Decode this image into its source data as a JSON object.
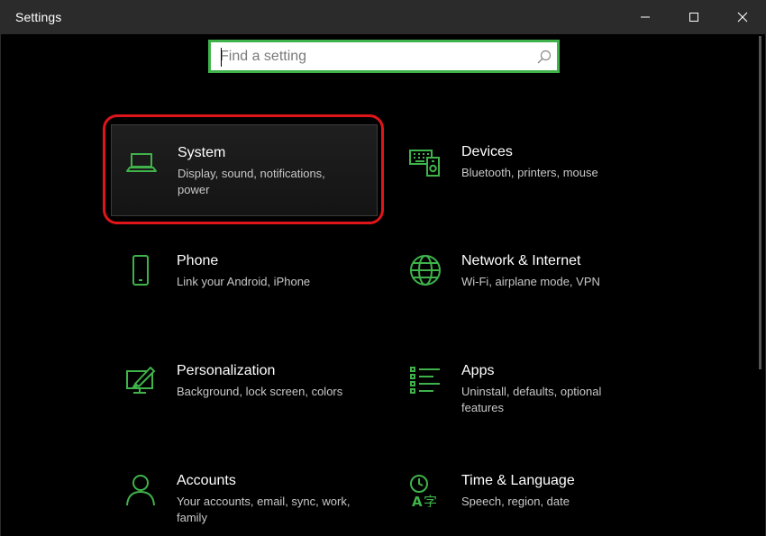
{
  "window": {
    "title": "Settings",
    "controls": [
      "minimize-icon",
      "maximize-icon",
      "close-icon"
    ]
  },
  "search": {
    "value": "",
    "placeholder": "Find a setting",
    "icon": "search-icon"
  },
  "colors": {
    "accent": "#3fb24a",
    "highlight_ring": "#e0151a",
    "background": "#000000",
    "titlebar": "#2b2b2b"
  },
  "tiles": [
    {
      "name": "System",
      "desc": "Display, sound, notifications, power",
      "icon": "laptop-icon",
      "selected": true
    },
    {
      "name": "Devices",
      "desc": "Bluetooth, printers, mouse",
      "icon": "keyboard-speaker-icon"
    },
    {
      "name": "Phone",
      "desc": "Link your Android, iPhone",
      "icon": "phone-icon"
    },
    {
      "name": "Network & Internet",
      "desc": "Wi-Fi, airplane mode, VPN",
      "icon": "globe-icon"
    },
    {
      "name": "Personalization",
      "desc": "Background, lock screen, colors",
      "icon": "paint-brush-icon"
    },
    {
      "name": "Apps",
      "desc": "Uninstall, defaults, optional features",
      "icon": "apps-list-icon"
    },
    {
      "name": "Accounts",
      "desc": "Your accounts, email, sync, work, family",
      "icon": "person-icon"
    },
    {
      "name": "Time & Language",
      "desc": "Speech, region, date",
      "icon": "time-language-icon"
    }
  ]
}
